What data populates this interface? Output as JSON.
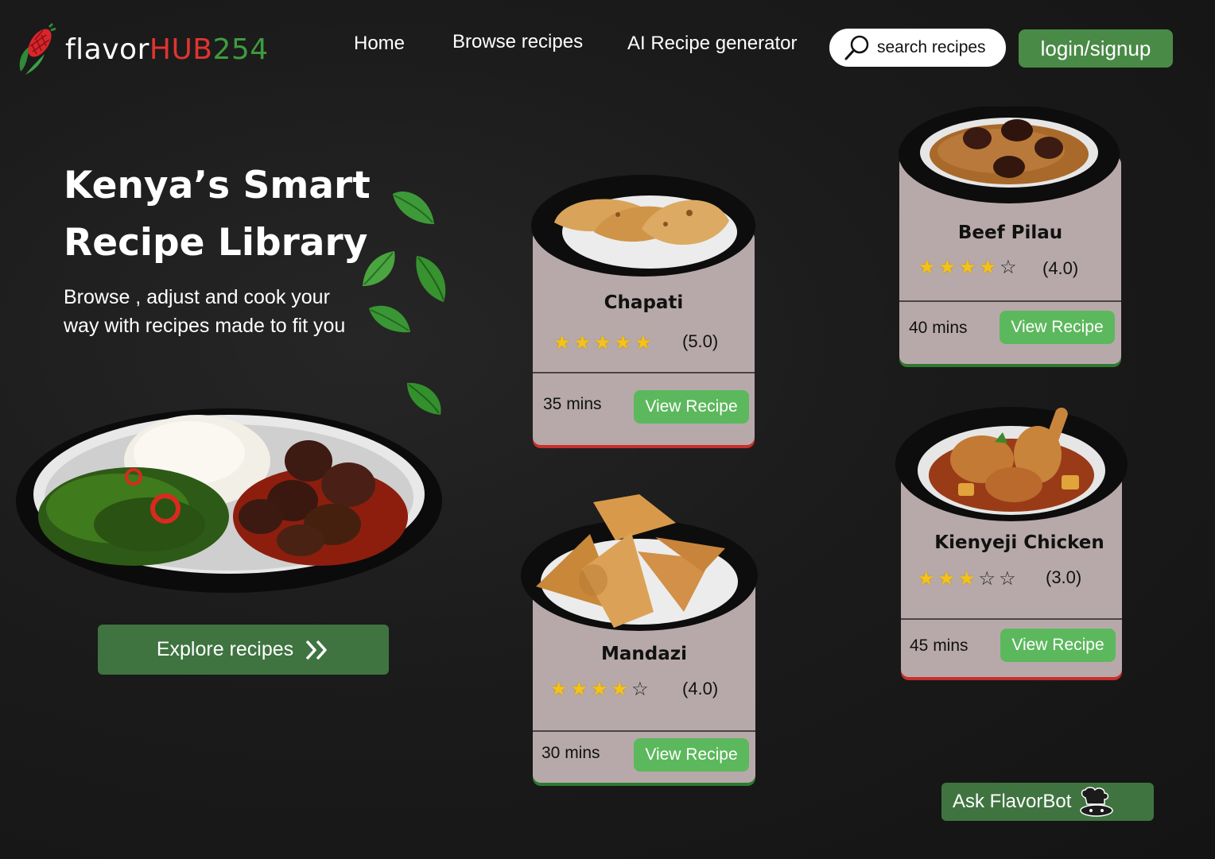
{
  "brand": {
    "part1": "flavor",
    "part2": "HUB",
    "part3": "254"
  },
  "nav": {
    "home": "Home",
    "browse": "Browse recipes",
    "ai": "AI Recipe generator"
  },
  "search": {
    "placeholder": "search recipes"
  },
  "login": {
    "label": "login/signup"
  },
  "hero": {
    "title": "Kenya’s Smart Recipe Library",
    "subtitle": "Browse , adjust and cook your way with recipes made to fit you",
    "explore_label": "Explore recipes"
  },
  "recipes": [
    {
      "name": "Chapati",
      "rating": "(5.0)",
      "stars_filled": 5,
      "time": "35 mins",
      "button": "View Recipe"
    },
    {
      "name": "Mandazi",
      "rating": "(4.0)",
      "stars_filled": 4,
      "time": "30 mins",
      "button": "View Recipe"
    },
    {
      "name": "Beef Pilau",
      "rating": "(4.0)",
      "stars_filled": 4,
      "time": "40 mins",
      "button": "View Recipe"
    },
    {
      "name": "Kienyeji Chicken",
      "rating": "(3.0)",
      "stars_filled": 3,
      "time": "45 mins",
      "button": "View Recipe"
    }
  ],
  "bot": {
    "label": "Ask FlavorBot"
  },
  "colors": {
    "accent_green": "#4a8a47",
    "button_green": "#5cb85c",
    "brand_red": "#e0342f",
    "card_bg": "#b7a9aa"
  },
  "icons": [
    "corn-logo-icon",
    "search-icon",
    "double-chevron-icon",
    "chef-hat-icon",
    "star-icon"
  ]
}
